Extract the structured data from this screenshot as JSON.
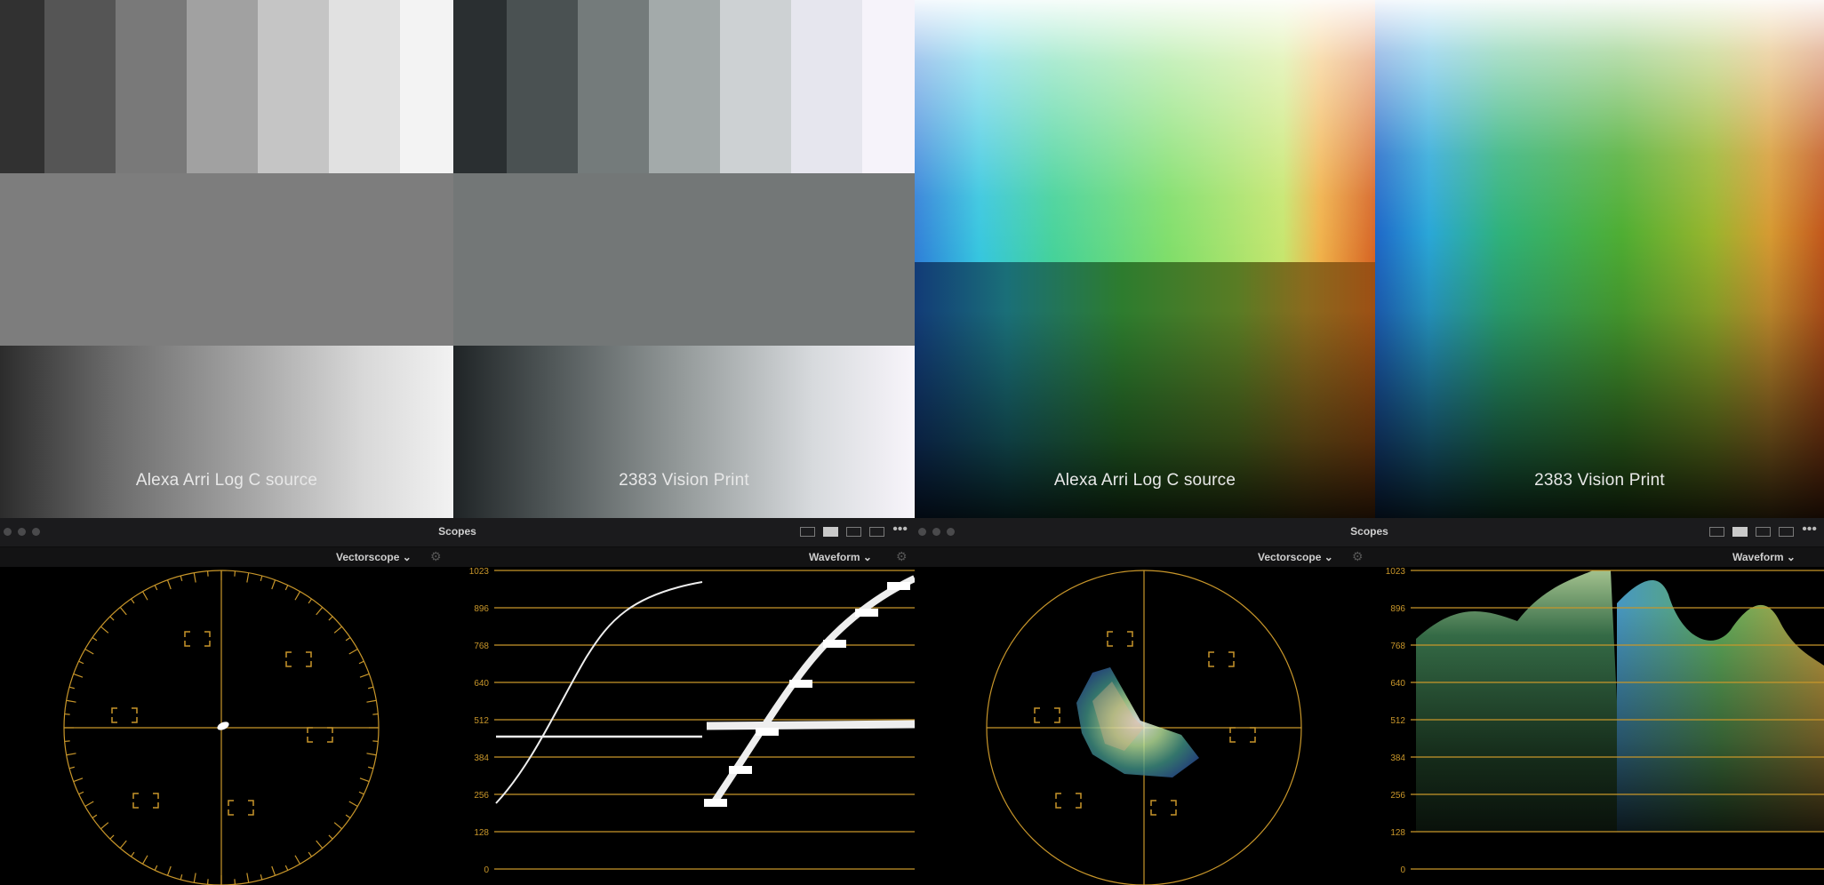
{
  "captions": {
    "q1": "Alexa Arri Log C source",
    "q2": "2383  Vision Print",
    "q3": "Alexa Arri Log C source",
    "q4": "2383  Vision Print"
  },
  "scopes_left": {
    "title": "Scopes",
    "vectorscope_label": "Vectorscope",
    "waveform_label": "Waveform"
  },
  "scopes_right": {
    "title": "Scopes",
    "vectorscope_label": "Vectorscope",
    "waveform_label": "Waveform"
  },
  "waveform_ticks": [
    "1023",
    "896",
    "768",
    "640",
    "512",
    "384",
    "256",
    "128",
    "0"
  ],
  "vectorscope_targets": [
    "R",
    "M",
    "B",
    "C",
    "G",
    "Y"
  ],
  "colors": {
    "graticule": "#c8962a",
    "panel_bg": "#1b1b1d"
  }
}
